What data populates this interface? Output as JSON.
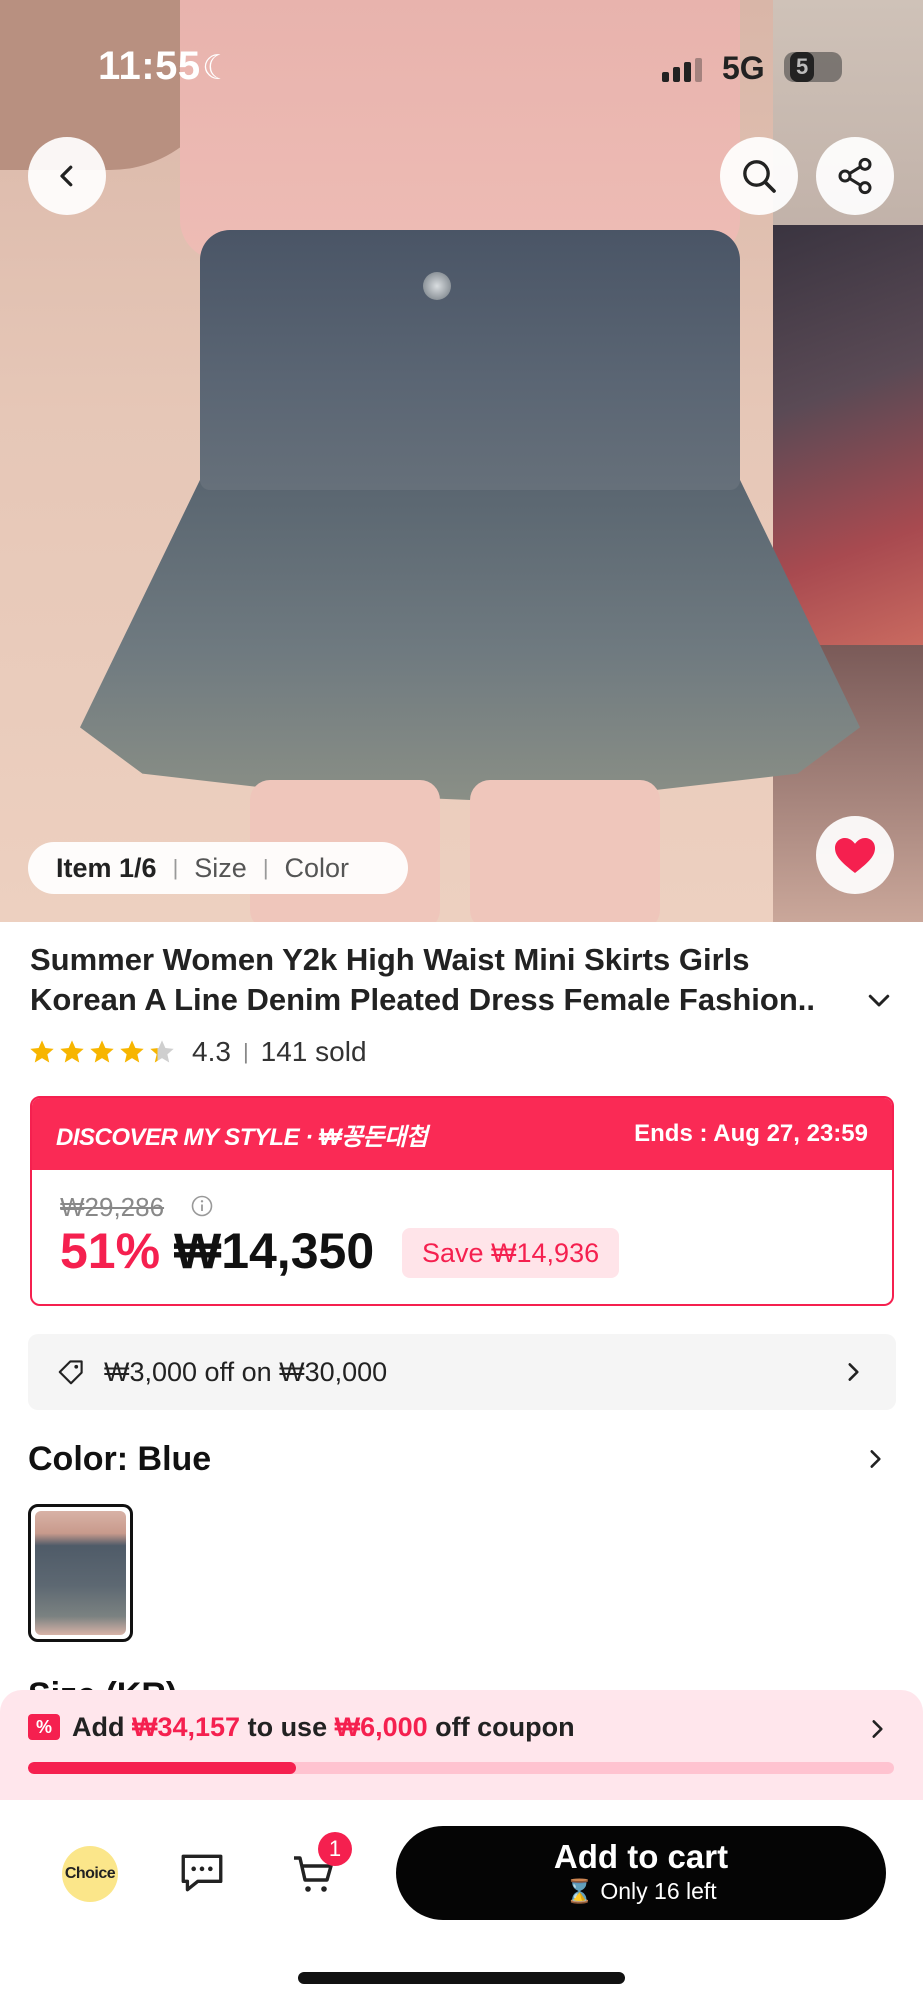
{
  "status_bar": {
    "time": "11:55",
    "network": "5G",
    "battery": "5"
  },
  "gallery": {
    "position": "Item 1/6",
    "tabs": [
      "Size",
      "Color"
    ]
  },
  "product": {
    "title_line1": "Summer Women Y2k High Waist Mini Skirts Girls",
    "title_line2": "Korean A Line Denim Pleated Dress Female Fashion..",
    "rating": "4.3",
    "sold": "141 sold",
    "stars_value": 4.3
  },
  "deal": {
    "banner": "DISCOVER MY STYLE · ₩꽁돈대첩",
    "ends": "Ends : Aug 27, 23:59",
    "original_price": "₩29,286",
    "discount": "51%",
    "price": "₩14,350",
    "save": "Save ₩14,936"
  },
  "coupon": {
    "text": "₩3,000 off on ₩30,000"
  },
  "color": {
    "label": "Color: Blue"
  },
  "size": {
    "label": "Size (KR)"
  },
  "promo": {
    "prefix": "Add ",
    "amount": "₩34,157",
    "middle": " to use ",
    "discount": "₩6,000",
    "suffix": " off coupon",
    "progress": 0.31
  },
  "bottom_bar": {
    "choice_label": "Choice",
    "cart_count": "1",
    "add_to_cart": "Add to cart",
    "stock_note": "⌛ Only 16 left"
  },
  "colors": {
    "accent": "#f5204f",
    "banner": "#fa2a55",
    "button": "#050505"
  }
}
